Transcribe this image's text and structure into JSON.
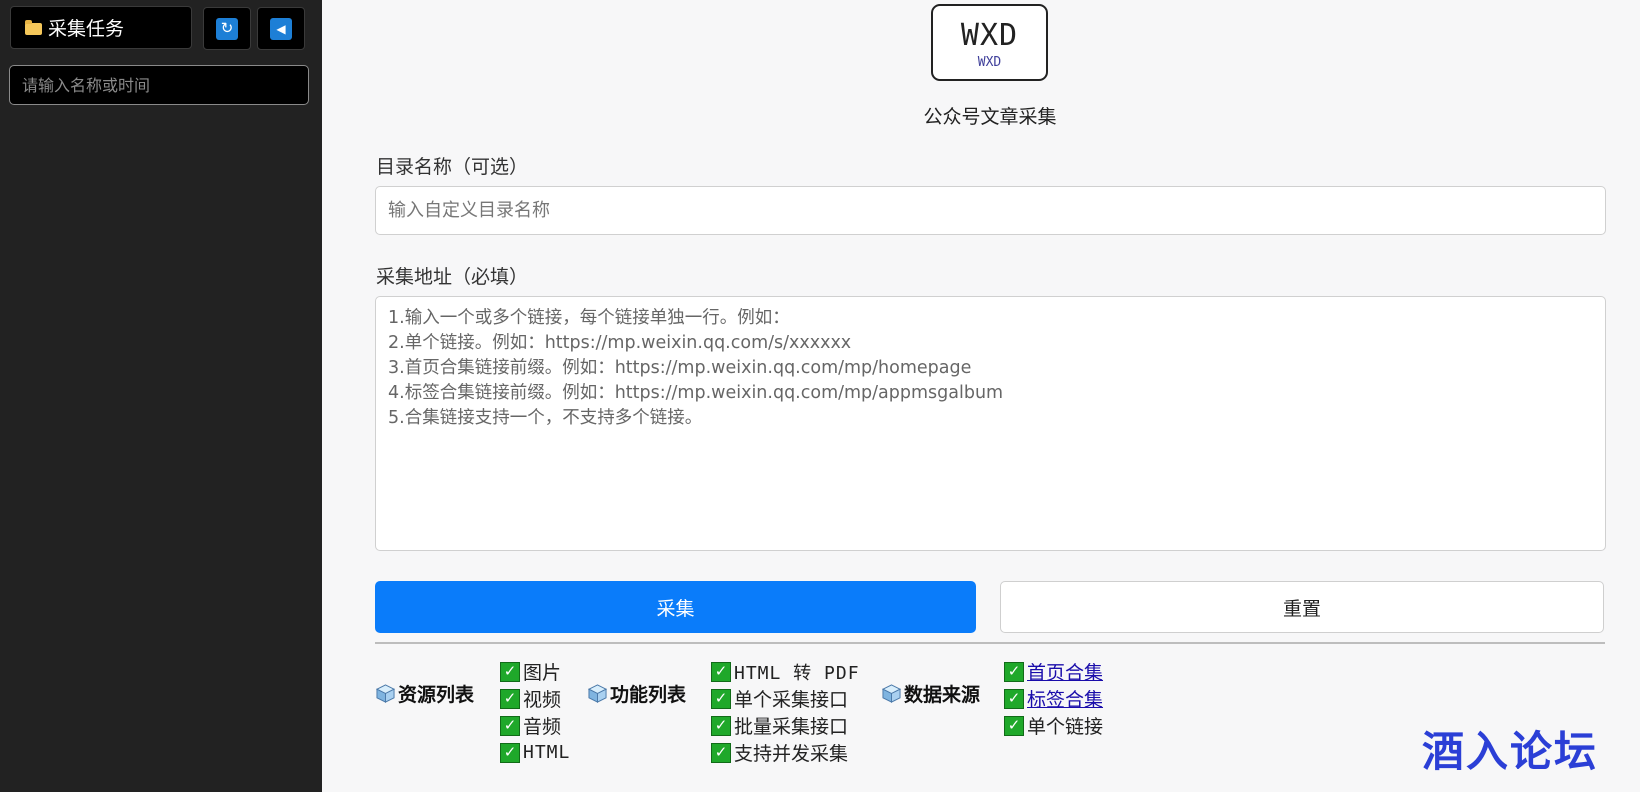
{
  "sidebar": {
    "title": "采集任务",
    "refresh_icon": "refresh-icon",
    "collapse_icon": "collapse-left-icon",
    "search_placeholder": "请输入名称或时间"
  },
  "header": {
    "logo_text": "WXD",
    "logo_subtext": "WXD",
    "subtitle": "公众号文章采集"
  },
  "form": {
    "dir_label": "目录名称（可选）",
    "dir_placeholder": "输入自定义目录名称",
    "url_label": "采集地址（必填）",
    "url_placeholder": "1.输入一个或多个链接，每个链接单独一行。例如：\n2.单个链接。例如：https://mp.weixin.qq.com/s/xxxxxx\n3.首页合集链接前缀。例如：https://mp.weixin.qq.com/mp/homepage\n4.标签合集链接前缀。例如：https://mp.weixin.qq.com/mp/appmsgalbum\n5.合集链接支持一个，不支持多个链接。",
    "collect_label": "采集",
    "reset_label": "重置"
  },
  "features": {
    "resources": {
      "title": "资源列表",
      "items": [
        "图片",
        "视频",
        "音频",
        "HTML"
      ]
    },
    "functions": {
      "title": "功能列表",
      "items": [
        "HTML 转 PDF",
        "单个采集接口",
        "批量采集接口",
        "支持并发采集"
      ]
    },
    "sources": {
      "title": "数据来源",
      "items": [
        "首页合集",
        "标签合集",
        "单个链接"
      ]
    }
  },
  "watermark": "酒入论坛",
  "colors": {
    "sidebar_bg": "#222222",
    "primary": "#0a7cfa",
    "check": "#1fa82a",
    "watermark": "#2b3fd6"
  }
}
